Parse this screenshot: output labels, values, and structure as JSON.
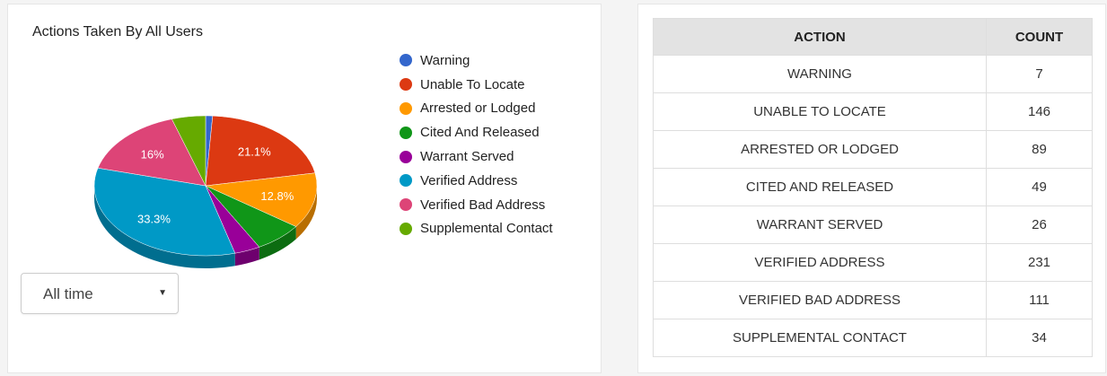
{
  "chart_data": {
    "type": "pie",
    "title": "Actions Taken By All Users",
    "categories": [
      "Warning",
      "Unable To Locate",
      "Arrested or Lodged",
      "Cited And Released",
      "Warrant Served",
      "Verified Address",
      "Verified Bad Address",
      "Supplemental Contact"
    ],
    "values": [
      7,
      146,
      89,
      49,
      26,
      231,
      111,
      34
    ],
    "colors": [
      "#3366cc",
      "#dc3912",
      "#ff9900",
      "#109618",
      "#990099",
      "#0099c6",
      "#dd4477",
      "#66aa00"
    ],
    "data_labels": [
      "",
      "21.1%",
      "12.8%",
      "",
      "",
      "33.3%",
      "16%",
      ""
    ],
    "legend_position": "right",
    "style": "3d"
  },
  "range_select": {
    "value": "All time",
    "caret_icon": "caret-down-icon"
  },
  "table": {
    "headers": {
      "action": "ACTION",
      "count": "COUNT"
    },
    "rows": [
      {
        "action": "WARNING",
        "count": "7"
      },
      {
        "action": "UNABLE TO LOCATE",
        "count": "146"
      },
      {
        "action": "ARRESTED OR LODGED",
        "count": "89"
      },
      {
        "action": "CITED AND RELEASED",
        "count": "49"
      },
      {
        "action": "WARRANT SERVED",
        "count": "26"
      },
      {
        "action": "VERIFIED ADDRESS",
        "count": "231"
      },
      {
        "action": "VERIFIED BAD ADDRESS",
        "count": "111"
      },
      {
        "action": "SUPPLEMENTAL CONTACT",
        "count": "34"
      }
    ]
  }
}
